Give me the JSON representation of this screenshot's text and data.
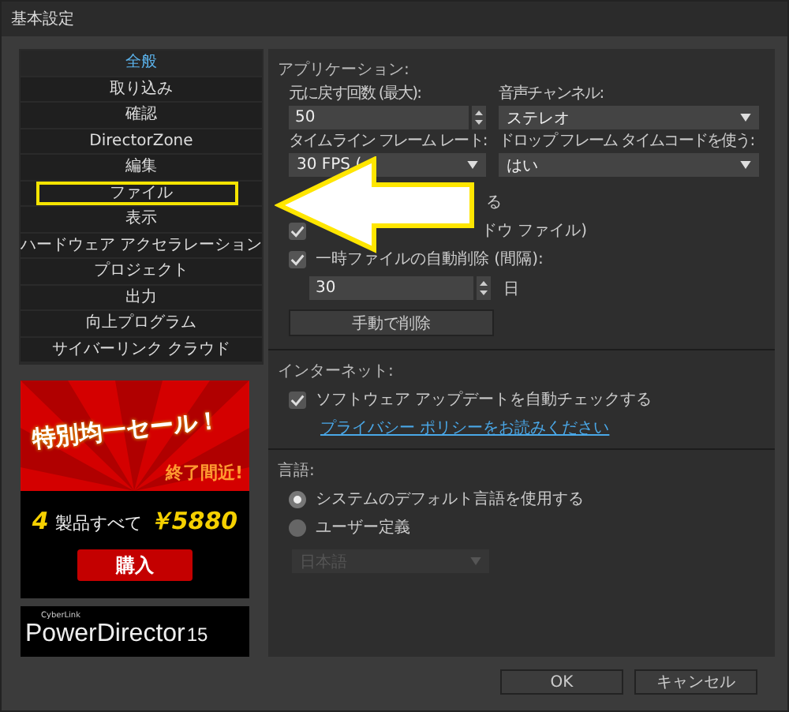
{
  "window": {
    "title": "基本設定"
  },
  "sidebar": {
    "items": [
      {
        "label": "全般",
        "selected": true,
        "highlighted": false
      },
      {
        "label": "取り込み",
        "selected": false,
        "highlighted": false
      },
      {
        "label": "確認",
        "selected": false,
        "highlighted": false
      },
      {
        "label": "DirectorZone",
        "selected": false,
        "highlighted": false
      },
      {
        "label": "編集",
        "selected": false,
        "highlighted": false
      },
      {
        "label": "ファイル",
        "selected": false,
        "highlighted": true
      },
      {
        "label": "表示",
        "selected": false,
        "highlighted": false
      },
      {
        "label": "ハードウェア アクセラレーション",
        "selected": false,
        "highlighted": false
      },
      {
        "label": "プロジェクト",
        "selected": false,
        "highlighted": false
      },
      {
        "label": "出力",
        "selected": false,
        "highlighted": false
      },
      {
        "label": "向上プログラム",
        "selected": false,
        "highlighted": false
      },
      {
        "label": "サイバーリンク クラウド",
        "selected": false,
        "highlighted": false
      }
    ]
  },
  "ad": {
    "headline": "特別均一セール！",
    "subline": "終了間近!",
    "count": "4",
    "offer": "製品すべて",
    "price": "￥5880",
    "button": "購入",
    "brand_small": "CyberLink",
    "brand": "PowerDirector",
    "version": "15"
  },
  "application": {
    "heading": "アプリケーション:",
    "undo_label": "元に戻す回数 (最大):",
    "undo_value": "50",
    "audio_label": "音声チャンネル:",
    "audio_value": "ステレオ",
    "framerate_label": "タイムライン フレーム レート:",
    "framerate_value": "30 FPS (",
    "dropframe_label": "ドロップ フレーム タイムコードを使う:",
    "dropframe_value": "はい",
    "checks": [
      {
        "label": "る",
        "covered": true
      },
      {
        "label": "ドウ ファイル)",
        "checked": true,
        "covered": true
      },
      {
        "label": "一時ファイルの自動削除 (間隔):",
        "checked": true,
        "covered": false
      }
    ],
    "days_value": "30",
    "days_unit": "日",
    "delete_button": "手動で削除"
  },
  "internet": {
    "heading": "インターネット:",
    "update_label": "ソフトウェア アップデートを自動チェックする",
    "update_checked": true,
    "privacy_link": "プライバシー ポリシーをお読みください"
  },
  "language": {
    "heading": "言語:",
    "options": [
      {
        "label": "システムのデフォルト言語を使用する",
        "selected": true
      },
      {
        "label": "ユーザー定義",
        "selected": false
      }
    ],
    "custom_value": "日本語",
    "custom_disabled": true
  },
  "buttons": [
    "OK",
    "キャンセル"
  ]
}
